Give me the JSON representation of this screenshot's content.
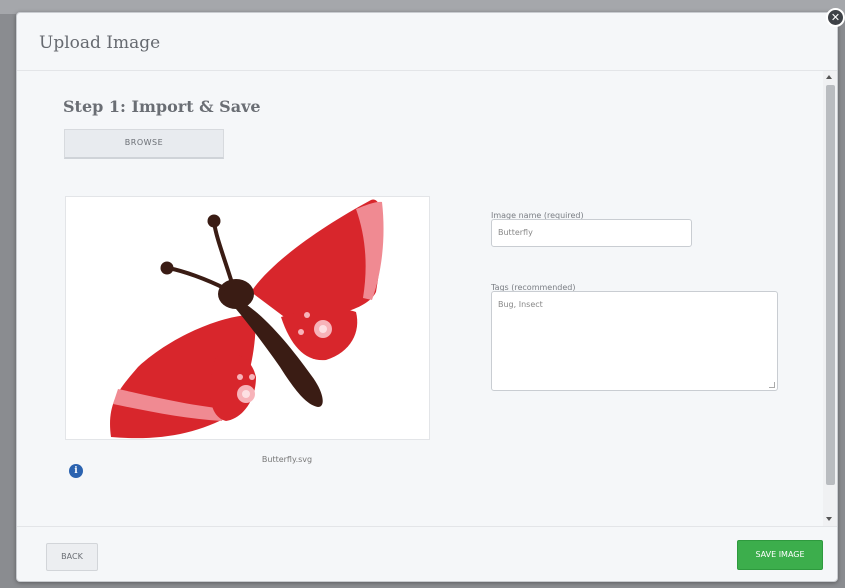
{
  "dialog": {
    "title": "Upload Image",
    "close_icon": "close-icon"
  },
  "step": {
    "title": "Step 1: Import & Save",
    "browse_label": "BROWSE"
  },
  "preview": {
    "file_name": "Butterfly.svg",
    "image_subject": "butterfly",
    "info_icon": "info-icon",
    "colors": {
      "wing_red": "#d8262c",
      "wing_stripe": "#f08a92",
      "body": "#3a1c14",
      "spot": "#f7b3b9"
    }
  },
  "form": {
    "name_label": "Image name (required)",
    "name_value": "Butterfly",
    "tags_label": "Tags (recommended)",
    "tags_value": "Bug, Insect"
  },
  "footer": {
    "back_label": "BACK",
    "save_label": "SAVE IMAGE",
    "save_color": "#3cae4c"
  }
}
